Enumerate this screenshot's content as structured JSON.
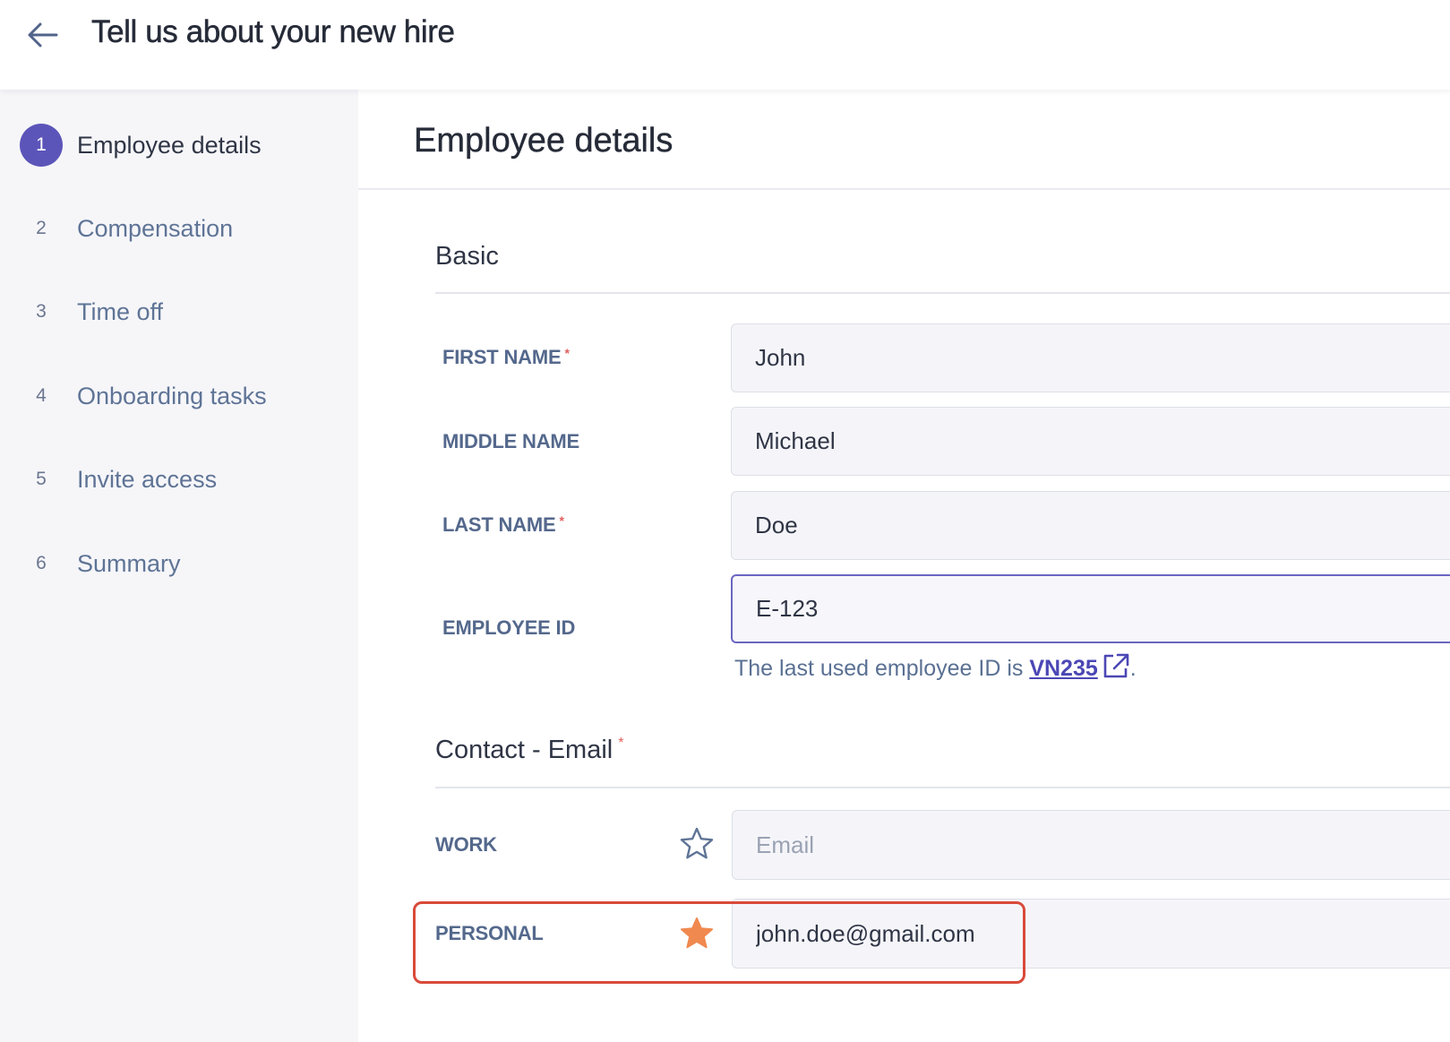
{
  "header": {
    "title": "Tell us about your new hire",
    "back_icon": "arrow-left-icon"
  },
  "sidebar": {
    "steps": [
      {
        "number": "1",
        "label": "Employee details",
        "active": true
      },
      {
        "number": "2",
        "label": "Compensation",
        "active": false
      },
      {
        "number": "3",
        "label": "Time off",
        "active": false
      },
      {
        "number": "4",
        "label": "Onboarding tasks",
        "active": false
      },
      {
        "number": "5",
        "label": "Invite access",
        "active": false
      },
      {
        "number": "6",
        "label": "Summary",
        "active": false
      }
    ]
  },
  "main": {
    "section_title": "Employee details",
    "basic": {
      "title": "Basic",
      "first_name": {
        "label": "FIRST NAME",
        "required_mark": "*",
        "value": "John"
      },
      "middle_name": {
        "label": "MIDDLE NAME",
        "value": "Michael"
      },
      "last_name": {
        "label": "LAST NAME",
        "required_mark": "*",
        "value": "Doe"
      },
      "employee_id": {
        "label": "EMPLOYEE ID",
        "value": "E-123",
        "helper_prefix": "The last used employee ID is ",
        "helper_link": "VN235",
        "helper_suffix": "."
      }
    },
    "contact_email": {
      "title": "Contact - Email",
      "required_mark": "*",
      "work": {
        "label": "WORK",
        "placeholder": "Email",
        "value": "",
        "primary": false
      },
      "personal": {
        "label": "PERSONAL",
        "value": "john.doe@gmail.com",
        "primary": true
      }
    }
  },
  "colors": {
    "accent": "#5c55b9",
    "required": "#e0605e",
    "star_active": "#f0894f",
    "highlight_border": "#d94a3a"
  }
}
